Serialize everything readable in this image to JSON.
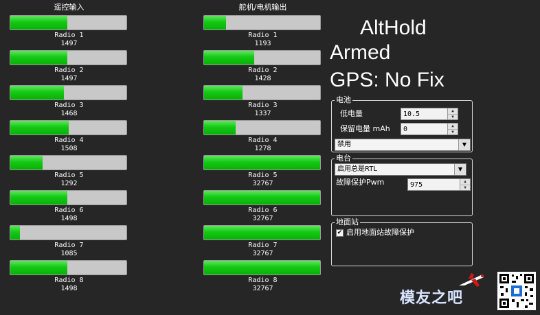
{
  "radio_input": {
    "title": "遥控输入",
    "channels": [
      {
        "label": "Radio 1",
        "value": "1497",
        "level": 0.49
      },
      {
        "label": "Radio 2",
        "value": "1497",
        "level": 0.49
      },
      {
        "label": "Radio 3",
        "value": "1468",
        "level": 0.46
      },
      {
        "label": "Radio 4",
        "value": "1508",
        "level": 0.5
      },
      {
        "label": "Radio 5",
        "value": "1292",
        "level": 0.28
      },
      {
        "label": "Radio 6",
        "value": "1498",
        "level": 0.49
      },
      {
        "label": "Radio 7",
        "value": "1085",
        "level": 0.08
      },
      {
        "label": "Radio 8",
        "value": "1498",
        "level": 0.49
      }
    ]
  },
  "servo_output": {
    "title": "舵机/电机输出",
    "channels": [
      {
        "label": "Radio 1",
        "value": "1193",
        "level": 0.19
      },
      {
        "label": "Radio 2",
        "value": "1428",
        "level": 0.43
      },
      {
        "label": "Radio 3",
        "value": "1337",
        "level": 0.33
      },
      {
        "label": "Radio 4",
        "value": "1278",
        "level": 0.27
      },
      {
        "label": "Radio 5",
        "value": "32767",
        "level": 1.0
      },
      {
        "label": "Radio 6",
        "value": "32767",
        "level": 1.0
      },
      {
        "label": "Radio 7",
        "value": "32767",
        "level": 1.0
      },
      {
        "label": "Radio 8",
        "value": "32767",
        "level": 1.0
      }
    ]
  },
  "status": {
    "mode": "AltHold",
    "armed": "Armed",
    "gps": "GPS: No Fix"
  },
  "battery": {
    "title": "电池",
    "low_voltage_label": "低电量",
    "low_voltage_value": "10.5",
    "reserve_mah_label": "保留电量 mAh",
    "reserve_mah_value": "0",
    "action_value": "禁用"
  },
  "radio": {
    "title": "电台",
    "action_value": "启用总是RTL",
    "failsafe_pwm_label": "故障保护Pwm",
    "failsafe_pwm_value": "975"
  },
  "gcs": {
    "title": "地面站",
    "enable_label": "启用地面站故障保护",
    "enabled": true
  },
  "watermark": {
    "text": "模友之吧"
  },
  "colors": {
    "background": "#262626",
    "bar_fill": "#15c915",
    "bar_empty": "#c8c8c8"
  }
}
